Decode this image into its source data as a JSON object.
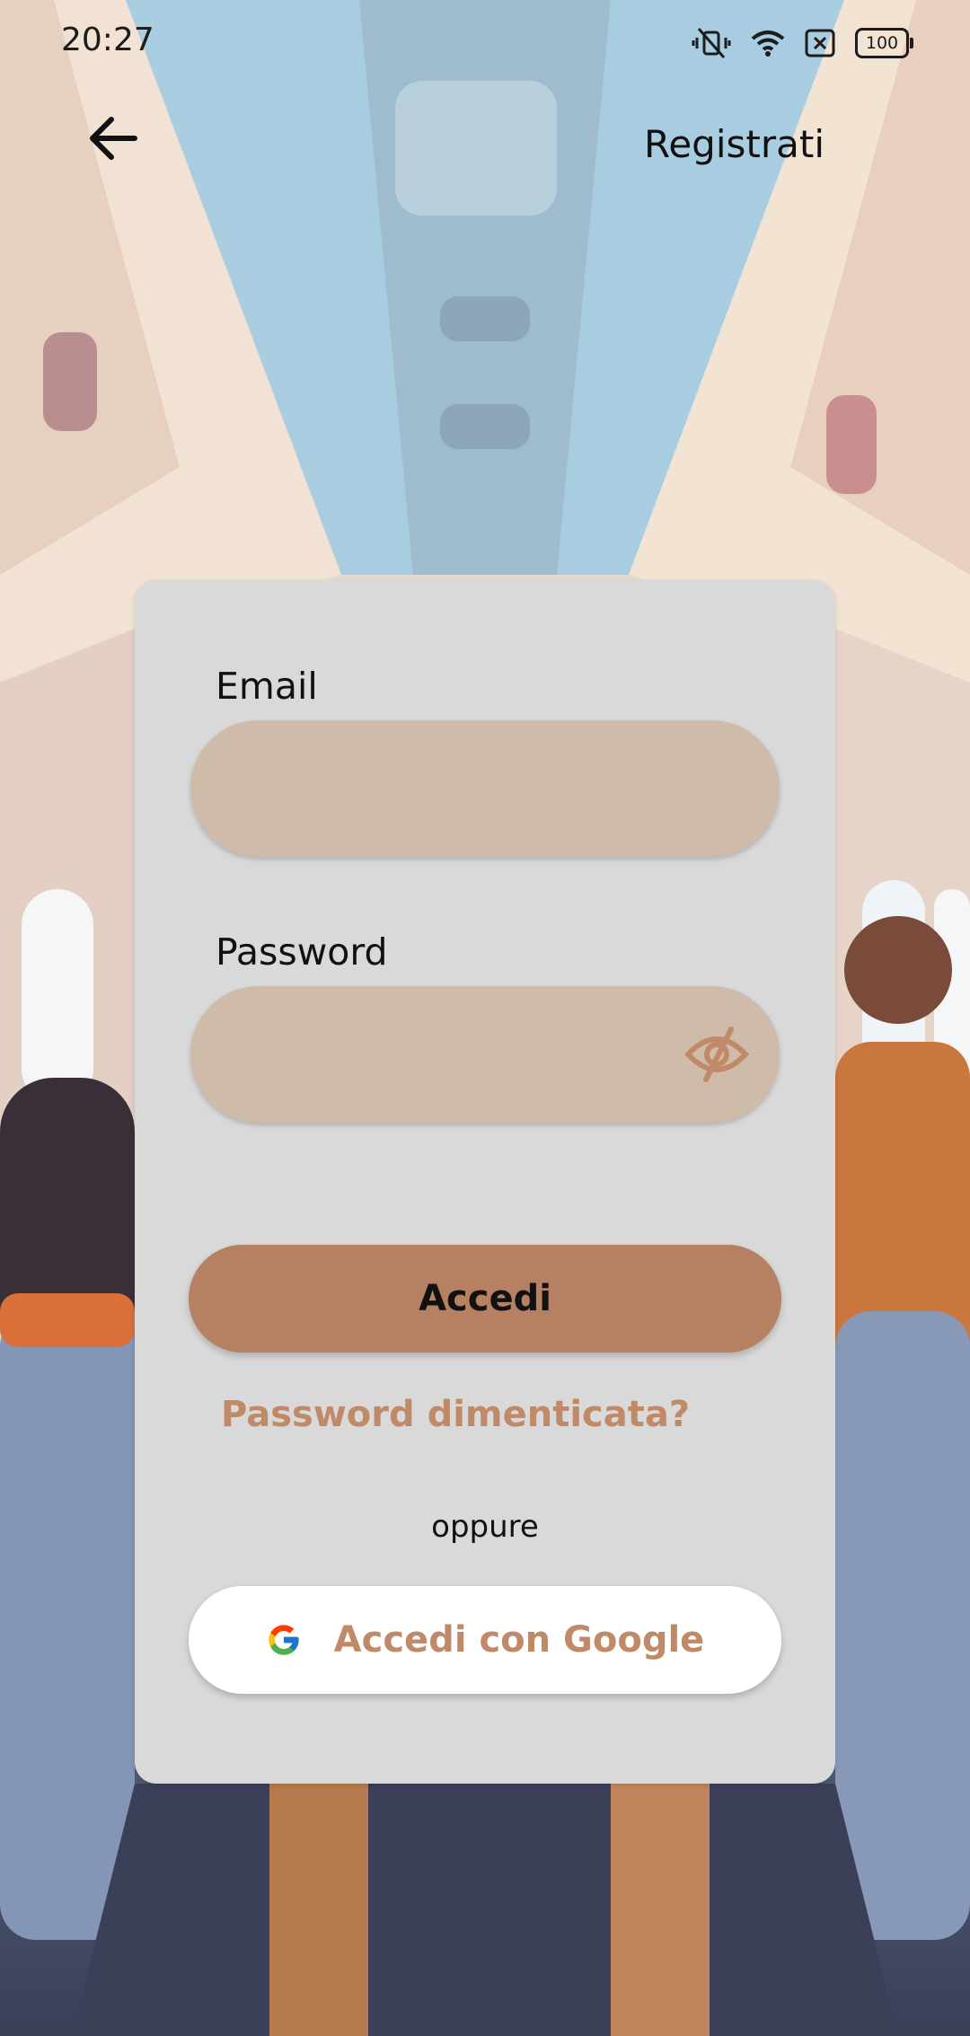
{
  "status_bar": {
    "time": "20:27",
    "battery_level": "100",
    "icons": [
      "vibrate-mute-icon",
      "wifi-icon",
      "no-sim-icon",
      "battery-icon"
    ]
  },
  "header": {
    "back_icon": "arrow-left-icon",
    "register_label": "Registrati"
  },
  "login_form": {
    "email": {
      "label": "Email",
      "value": "",
      "placeholder": ""
    },
    "password": {
      "label": "Password",
      "value": "",
      "placeholder": "",
      "toggle_icon": "eye-off-icon"
    },
    "submit_label": "Accedi",
    "forgot_password_label": "Password dimenticata?",
    "divider_label": "oppure",
    "google_button_label": "Accedi con Google"
  },
  "colors": {
    "card_background": "#d9d9d9",
    "input_background": "#cfbbaa",
    "primary_button": "#b68062",
    "accent_text": "#c08a69",
    "google_button_background": "#ffffff"
  }
}
